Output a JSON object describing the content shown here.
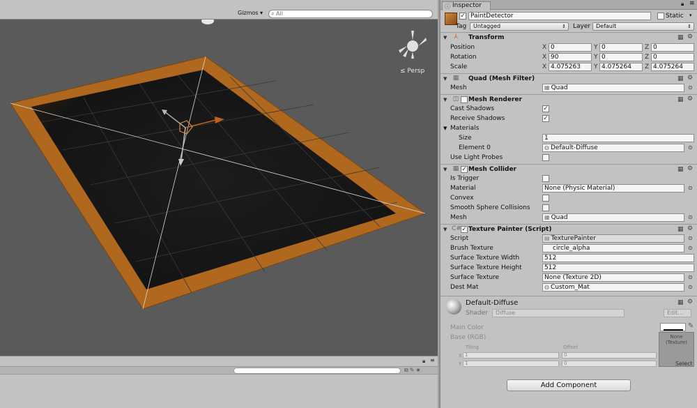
{
  "scene": {
    "gizmos_label": "Gizmos",
    "search_placeholder": "All",
    "persp_label": "Persp",
    "colors": {
      "floor": "#1a1a1a",
      "border": "#b0681f",
      "background": "#5a5a5a"
    }
  },
  "inspector": {
    "tab_label": "Inspector",
    "object": {
      "name": "PaintDetector",
      "static_label": "Static",
      "tag_label": "Tag",
      "tag_value": "Untagged",
      "layer_label": "Layer",
      "layer_value": "Default"
    },
    "transform": {
      "title": "Transform",
      "position_label": "Position",
      "rotation_label": "Rotation",
      "scale_label": "Scale",
      "axis_x": "X",
      "axis_y": "Y",
      "axis_z": "Z",
      "position": {
        "x": "0",
        "y": "0",
        "z": "0"
      },
      "rotation": {
        "x": "90",
        "y": "0",
        "z": "0"
      },
      "scale": {
        "x": "4.075263",
        "y": "4.075264",
        "z": "4.075264"
      }
    },
    "mesh_filter": {
      "title": "Quad (Mesh Filter)",
      "mesh_label": "Mesh",
      "mesh_value": "Quad"
    },
    "mesh_renderer": {
      "title": "Mesh Renderer",
      "cast_shadows_label": "Cast Shadows",
      "cast_shadows": true,
      "receive_shadows_label": "Receive Shadows",
      "receive_shadows": true,
      "materials_label": "Materials",
      "size_label": "Size",
      "size_value": "1",
      "element0_label": "Element 0",
      "element0_value": "Default-Diffuse",
      "light_probes_label": "Use Light Probes",
      "light_probes": false
    },
    "mesh_collider": {
      "title": "Mesh Collider",
      "is_trigger_label": "Is Trigger",
      "material_label": "Material",
      "material_value": "None (Physic Material)",
      "convex_label": "Convex",
      "smooth_label": "Smooth Sphere Collisions",
      "mesh_label": "Mesh",
      "mesh_value": "Quad"
    },
    "texture_painter": {
      "title": "Texture Painter (Script)",
      "script_label": "Script",
      "script_value": "TexturePainter",
      "brush_label": "Brush Texture",
      "brush_value": "circle_alpha",
      "width_label": "Surface Texture Width",
      "width_value": "512",
      "height_label": "Surface Texture Height",
      "height_value": "512",
      "surface_label": "Surface Texture",
      "surface_value": "None (Texture 2D)",
      "dest_label": "Dest Mat",
      "dest_value": "Custom_Mat"
    },
    "material": {
      "name": "Default-Diffuse",
      "shader_label": "Shader",
      "shader_value": "Diffuse",
      "edit_label": "Edit...",
      "main_color_label": "Main Color",
      "base_label": "Base (RGB)",
      "tiling_label": "Tiling",
      "offset_label": "Offset",
      "tiling_x": "1",
      "tiling_y": "1",
      "offset_x": "0",
      "offset_y": "0",
      "tex_label": "None (Texture)",
      "select_label": "Select"
    },
    "add_component_label": "Add Component"
  }
}
